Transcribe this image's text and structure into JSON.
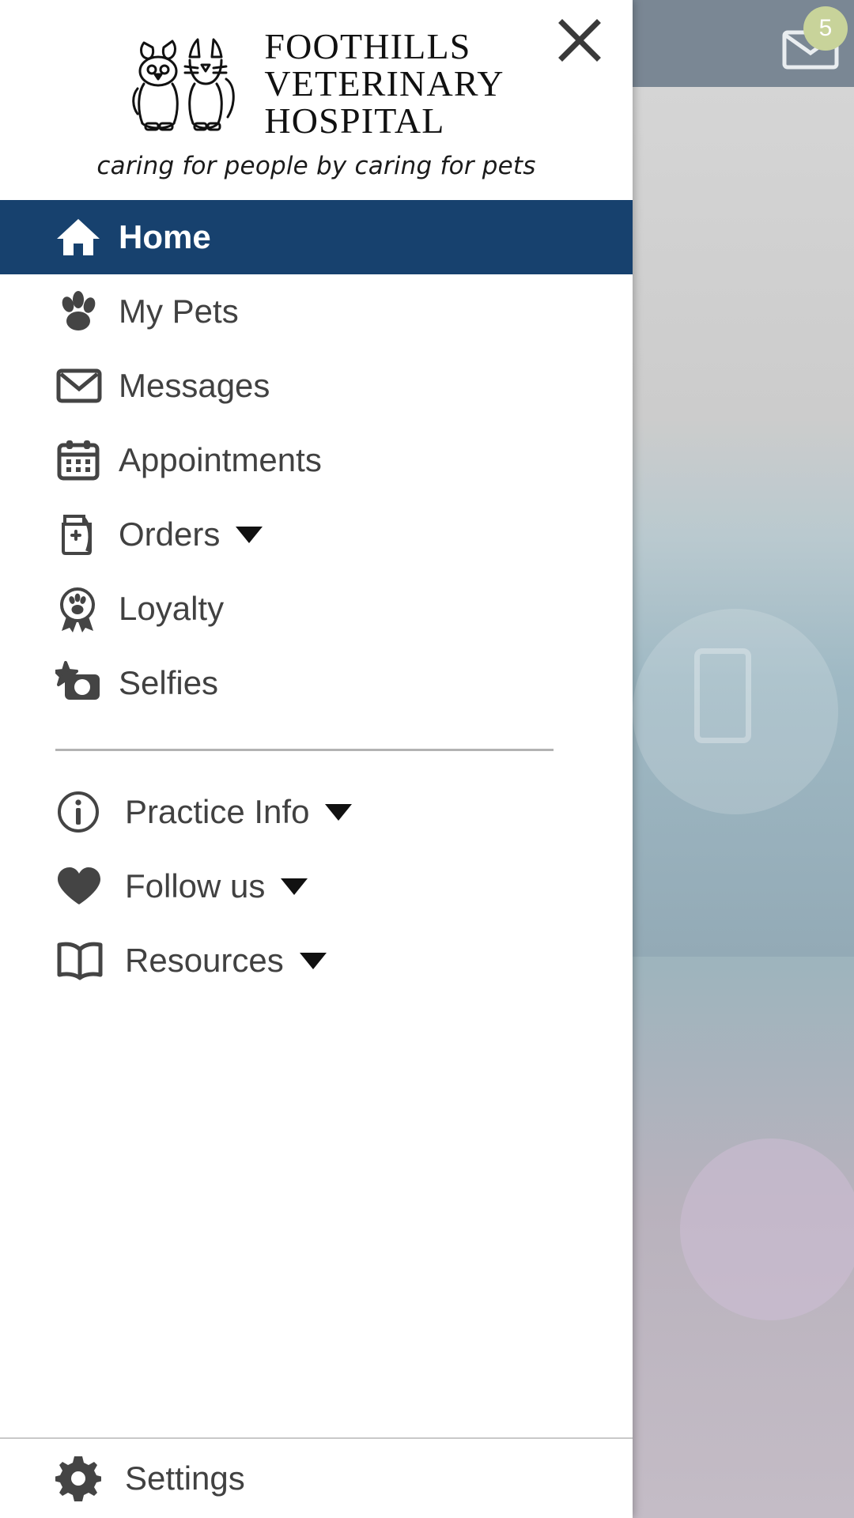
{
  "background": {
    "badge_count": "5",
    "mail_icon": "mail-icon"
  },
  "drawer": {
    "close_label": "×",
    "logo": {
      "mark": "dog-and-cat-logo-icon",
      "line1": "FOOTHILLS",
      "line2": "VETERINARY",
      "line3": "HOSPITAL",
      "tagline": "caring for people by caring for pets"
    },
    "accent_color": "#17416e",
    "text_color": "#414141",
    "primary_items": [
      {
        "label": "Home",
        "icon": "home-icon",
        "active": true,
        "caret": false
      },
      {
        "label": "My Pets",
        "icon": "paw-icon",
        "active": false,
        "caret": false
      },
      {
        "label": "Messages",
        "icon": "envelope-icon",
        "active": false,
        "caret": false
      },
      {
        "label": "Appointments",
        "icon": "calendar-icon",
        "active": false,
        "caret": false
      },
      {
        "label": "Orders",
        "icon": "food-bag-icon",
        "active": false,
        "caret": true
      },
      {
        "label": "Loyalty",
        "icon": "award-paw-icon",
        "active": false,
        "caret": false
      },
      {
        "label": "Selfies",
        "icon": "camera-star-icon",
        "active": false,
        "caret": false
      }
    ],
    "secondary_items": [
      {
        "label": "Practice Info",
        "icon": "info-circle-icon",
        "caret": true
      },
      {
        "label": "Follow us",
        "icon": "heart-icon",
        "caret": true
      },
      {
        "label": "Resources",
        "icon": "book-icon",
        "caret": true
      }
    ],
    "bottom_items": [
      {
        "label": "Settings",
        "icon": "gear-icon",
        "caret": false
      }
    ]
  }
}
